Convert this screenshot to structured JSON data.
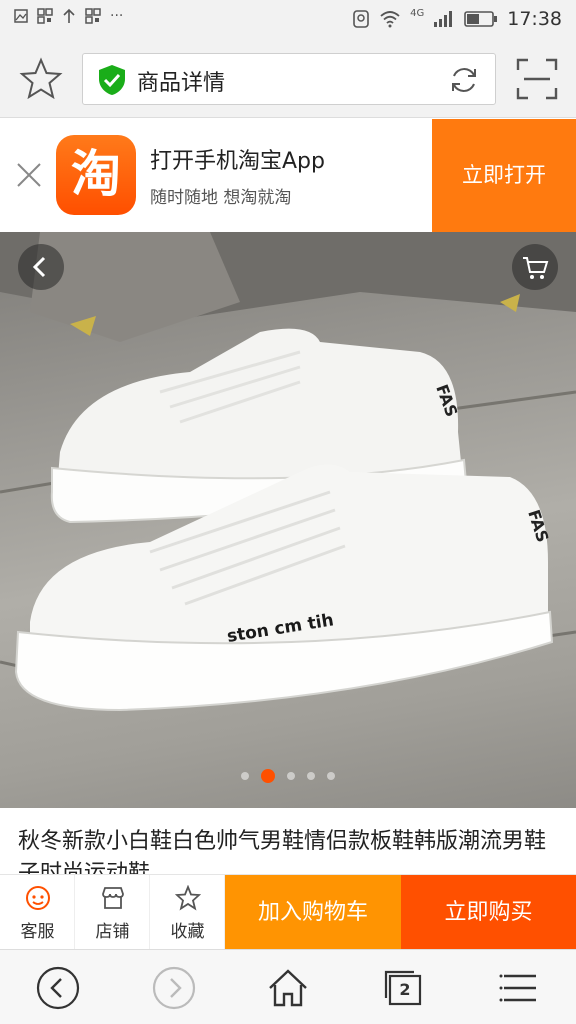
{
  "status_bar": {
    "network": "4G",
    "time": "17:38"
  },
  "address_bar": {
    "page_title": "商品详情"
  },
  "app_banner": {
    "logo_text": "淘",
    "title": "打开手机淘宝App",
    "subtitle": "随时随地 想淘就淘",
    "open_button": "立即打开"
  },
  "product_image": {
    "shoe_print": "ston cm tih",
    "heel_print": "FAS",
    "carousel_active_index": 1,
    "carousel_count": 5
  },
  "product": {
    "title": "秋冬新款小白鞋白色帅气男鞋情侣款板鞋韩版潮流男鞋子时尚运动鞋"
  },
  "action_bar": {
    "service_label": "客服",
    "shop_label": "店铺",
    "favorite_label": "收藏",
    "add_to_cart": "加入购物车",
    "buy_now": "立即购买"
  },
  "bottom_nav": {
    "tabs_count": "2"
  },
  "colors": {
    "accent_orange": "#ff9402",
    "buy_red_orange": "#ff5000",
    "banner_orange": "#ff7a0f"
  }
}
